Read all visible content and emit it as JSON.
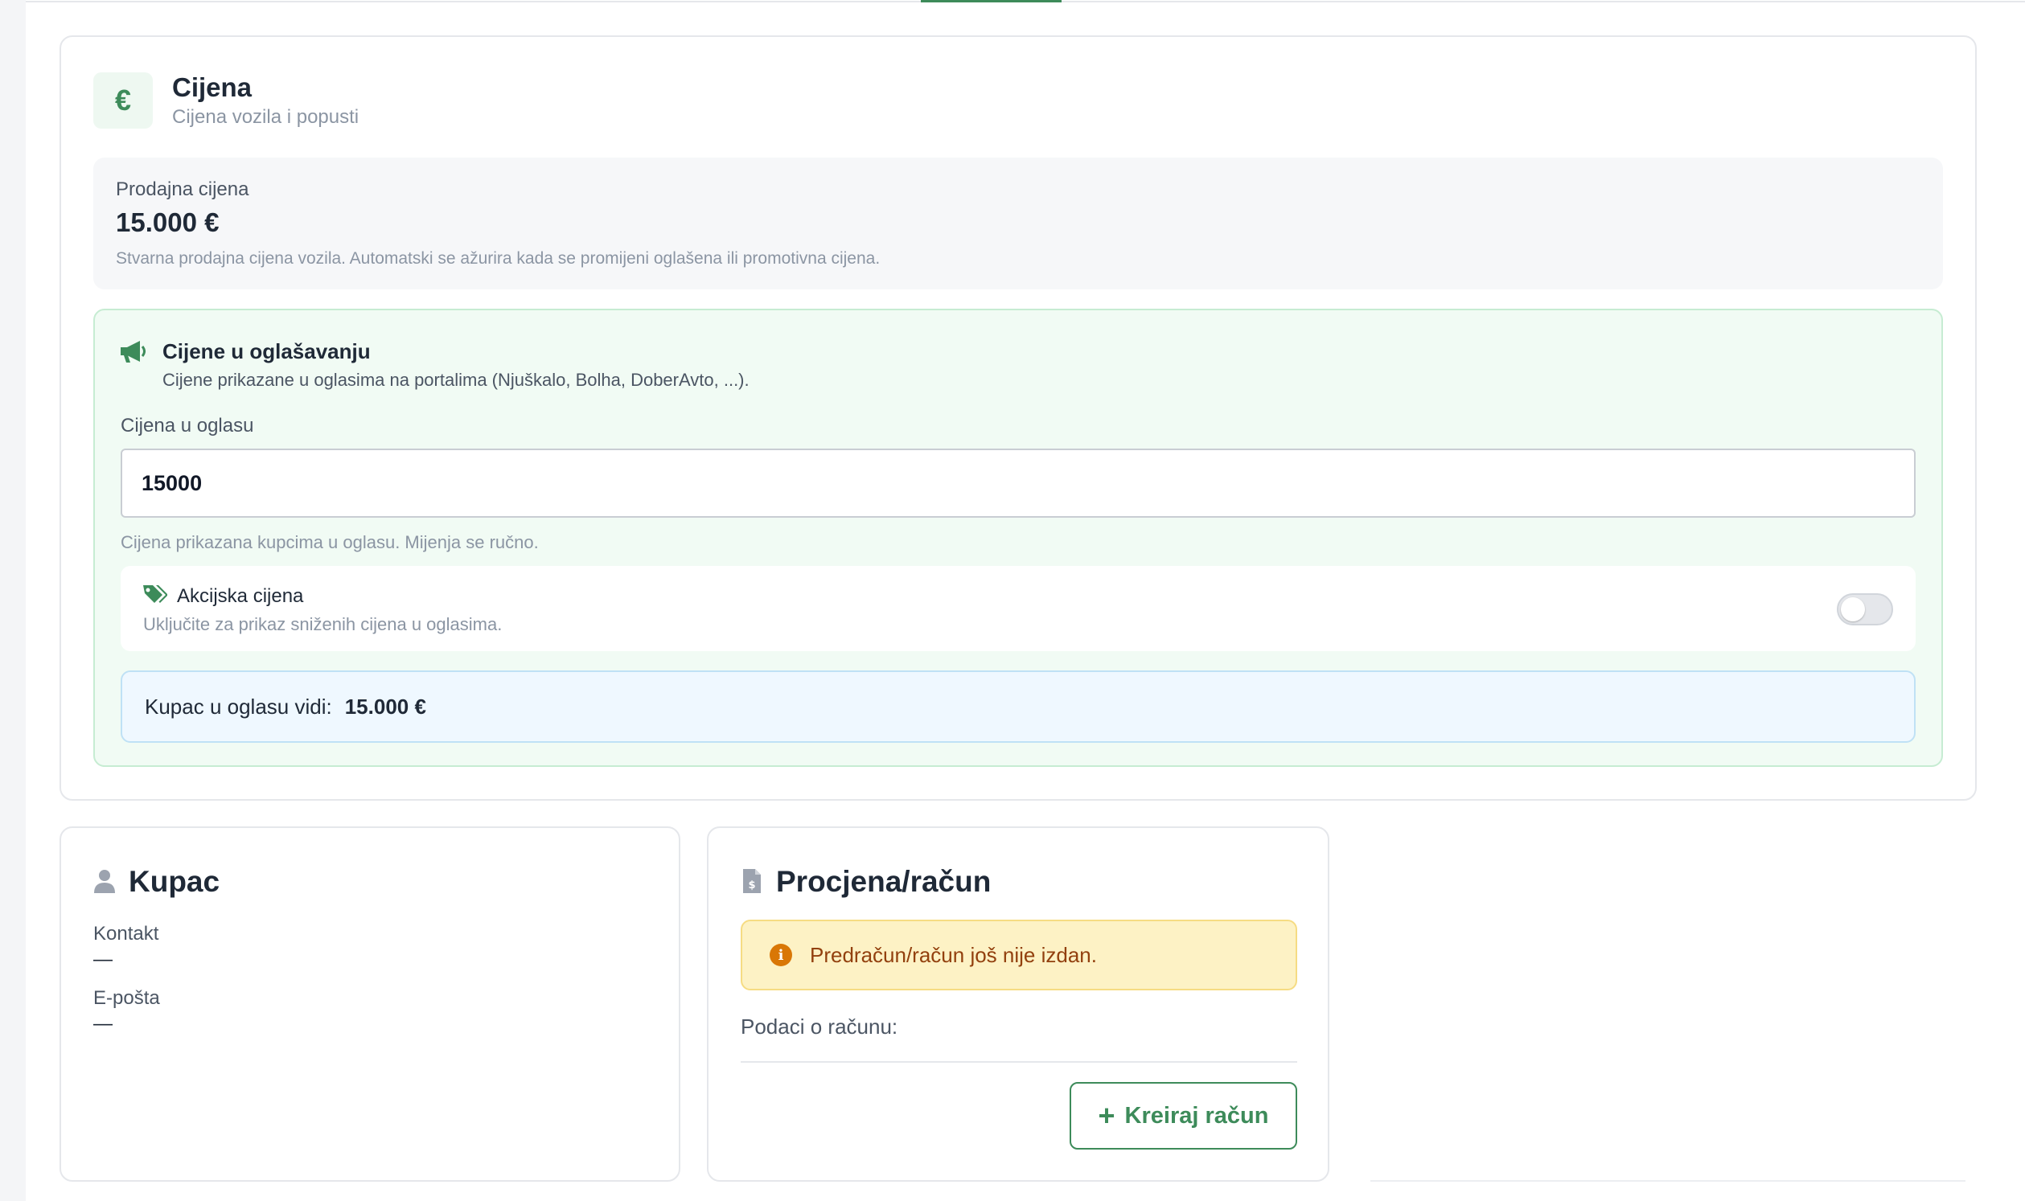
{
  "price": {
    "icon": "euro-icon",
    "icon_glyph": "€",
    "title": "Cijena",
    "subtitle": "Cijena vozila i popusti",
    "sale_label": "Prodajna cijena",
    "sale_value": "15.000 €",
    "sale_note": "Stvarna prodajna cijena vozila. Automatski se ažurira kada se promijeni oglašena ili promotivna cijena."
  },
  "advertising": {
    "icon": "megaphone-icon",
    "title": "Cijene u oglašavanju",
    "subtitle": "Cijene prikazane u oglasima na portalima (Njuškalo, Bolha, DoberAvto, ...).",
    "field_label": "Cijena u oglasu",
    "field_value": "15000",
    "field_hint": "Cijena prikazana kupcima u oglasu. Mijenja se ručno.",
    "promo_icon": "tags-icon",
    "promo_title": "Akcijska cijena",
    "promo_subtitle": "Uključite za prikaz sniženih cijena u oglasima.",
    "promo_enabled": false,
    "buyer_sees_label": "Kupac u oglasu vidi:",
    "buyer_sees_value": "15.000 €"
  },
  "buyer": {
    "icon": "user-icon",
    "title": "Kupac",
    "contact_label": "Kontakt",
    "contact_value": "—",
    "email_label": "E-pošta",
    "email_value": "—"
  },
  "invoice": {
    "icon": "invoice-icon",
    "title": "Procjena/račun",
    "warning_icon": "info-icon",
    "warning": "Predračun/račun još nije izdan.",
    "details_label": "Podaci o računu:",
    "create_button": "Kreiraj račun"
  },
  "colors": {
    "accent_green": "#3d8b5a",
    "warning_bg": "#fdf2c5",
    "info_bg": "#eff8ff"
  }
}
